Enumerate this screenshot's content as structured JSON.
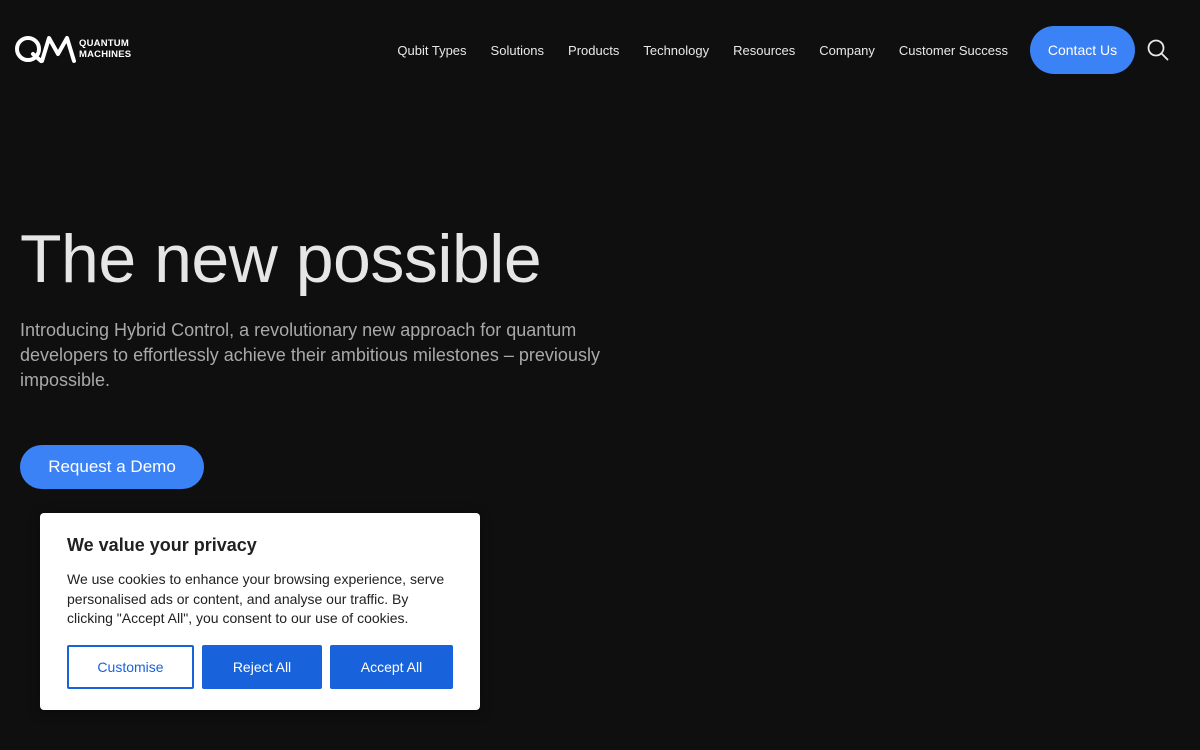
{
  "header": {
    "logo": {
      "line1": "QUANTUM",
      "line2": "MACHINES"
    },
    "nav": [
      {
        "label": "Qubit Types"
      },
      {
        "label": "Solutions"
      },
      {
        "label": "Products"
      },
      {
        "label": "Technology"
      },
      {
        "label": "Resources"
      },
      {
        "label": "Company"
      },
      {
        "label": "Customer Success"
      }
    ],
    "contact_label": "Contact Us",
    "search_icon": "search-icon"
  },
  "hero": {
    "title": "The new possible",
    "subtitle": "Introducing Hybrid Control, a revolutionary new approach for quantum developers to effortlessly achieve their ambitious milestones – previously impossible.",
    "cta_label": "Request a Demo"
  },
  "cookie_banner": {
    "title": "We value your privacy",
    "text": "We use cookies to enhance your browsing experience, serve personalised ads or content, and analyse our traffic. By clicking \"Accept All\", you consent to our use of cookies.",
    "customise_label": "Customise",
    "reject_label": "Reject All",
    "accept_label": "Accept All"
  },
  "colors": {
    "background": "#0f0f10",
    "accent": "#3b82f6",
    "cookie_button": "#1863dc"
  }
}
